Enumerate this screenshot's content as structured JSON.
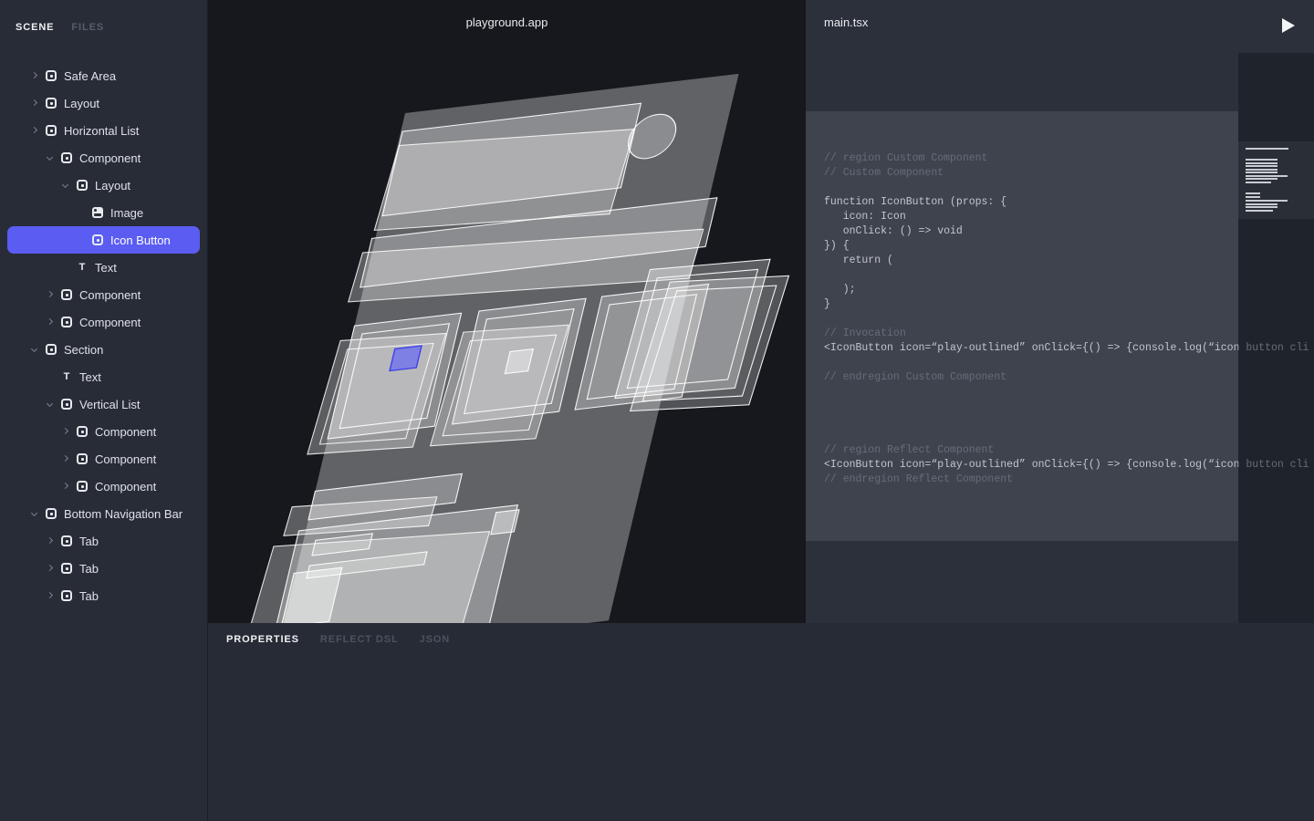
{
  "sidebar": {
    "tabs": [
      {
        "label": "SCENE",
        "active": true
      },
      {
        "label": "FILES",
        "active": false
      }
    ],
    "tree": [
      {
        "label": "Safe Area",
        "depth": 0,
        "arrow": "collapsed",
        "icon": "component",
        "selected": false
      },
      {
        "label": "Layout",
        "depth": 0,
        "arrow": "collapsed",
        "icon": "component",
        "selected": false
      },
      {
        "label": "Horizontal List",
        "depth": 0,
        "arrow": "collapsed",
        "icon": "component",
        "selected": false
      },
      {
        "label": "Component",
        "depth": 1,
        "arrow": "expanded",
        "icon": "component",
        "selected": false
      },
      {
        "label": "Layout",
        "depth": 2,
        "arrow": "expanded",
        "icon": "component",
        "selected": false
      },
      {
        "label": "Image",
        "depth": 3,
        "arrow": "none",
        "icon": "image",
        "selected": false
      },
      {
        "label": "Icon Button",
        "depth": 3,
        "arrow": "none",
        "icon": "component",
        "selected": true
      },
      {
        "label": "Text",
        "depth": 2,
        "arrow": "none",
        "icon": "text",
        "selected": false
      },
      {
        "label": "Component",
        "depth": 1,
        "arrow": "collapsed",
        "icon": "component",
        "selected": false
      },
      {
        "label": "Component",
        "depth": 1,
        "arrow": "collapsed",
        "icon": "component",
        "selected": false
      },
      {
        "label": "Section",
        "depth": 0,
        "arrow": "expanded",
        "icon": "component",
        "selected": false
      },
      {
        "label": "Text",
        "depth": 1,
        "arrow": "none",
        "icon": "text",
        "selected": false
      },
      {
        "label": "Vertical List",
        "depth": 1,
        "arrow": "expanded",
        "icon": "component",
        "selected": false
      },
      {
        "label": "Component",
        "depth": 2,
        "arrow": "collapsed",
        "icon": "component",
        "selected": false
      },
      {
        "label": "Component",
        "depth": 2,
        "arrow": "collapsed",
        "icon": "component",
        "selected": false
      },
      {
        "label": "Component",
        "depth": 2,
        "arrow": "collapsed",
        "icon": "component",
        "selected": false
      },
      {
        "label": "Bottom Navigation Bar",
        "depth": 0,
        "arrow": "expanded",
        "icon": "component",
        "selected": false
      },
      {
        "label": "Tab",
        "depth": 1,
        "arrow": "collapsed",
        "icon": "component",
        "selected": false
      },
      {
        "label": "Tab",
        "depth": 1,
        "arrow": "collapsed",
        "icon": "component",
        "selected": false
      },
      {
        "label": "Tab",
        "depth": 1,
        "arrow": "collapsed",
        "icon": "component",
        "selected": false
      }
    ]
  },
  "canvas": {
    "title": "playground.app"
  },
  "editor": {
    "filename": "main.tsx",
    "play_icon": "play-triangle",
    "code_lines": [
      {
        "type": "comment",
        "text": "// region Custom Component"
      },
      {
        "type": "comment",
        "text": "// Custom Component"
      },
      {
        "type": "blank",
        "text": ""
      },
      {
        "type": "code",
        "text": "function IconButton (props: {"
      },
      {
        "type": "code",
        "text": "   icon: Icon"
      },
      {
        "type": "code",
        "text": "   onClick: () => void"
      },
      {
        "type": "code",
        "text": "}) {"
      },
      {
        "type": "code",
        "text": "   return ("
      },
      {
        "type": "blank",
        "text": ""
      },
      {
        "type": "code",
        "text": "   );"
      },
      {
        "type": "code",
        "text": "}"
      },
      {
        "type": "blank",
        "text": ""
      },
      {
        "type": "comment",
        "text": "// Invocation"
      },
      {
        "type": "code",
        "text": "<IconButton icon=“play-outlined” onClick={() => {console.log(“icon button cli"
      },
      {
        "type": "blank",
        "text": ""
      },
      {
        "type": "comment",
        "text": "// endregion Custom Component"
      },
      {
        "type": "blank",
        "text": ""
      },
      {
        "type": "blank",
        "text": ""
      },
      {
        "type": "blank",
        "text": ""
      },
      {
        "type": "blank",
        "text": ""
      },
      {
        "type": "comment",
        "text": "// region Reflect Component"
      },
      {
        "type": "code",
        "text": "<IconButton icon=“play-outlined” onClick={() => {console.log(“icon button cli"
      },
      {
        "type": "comment",
        "text": "// endregion Reflect Component"
      }
    ],
    "minimap_lines": [
      [
        104,
        47
      ],
      [
        116,
        35
      ],
      [
        119.5,
        35
      ],
      [
        123,
        35
      ],
      [
        126.5,
        35
      ],
      [
        130,
        35
      ],
      [
        133.5,
        46
      ],
      [
        137,
        35
      ],
      [
        140.5,
        28
      ],
      [
        153,
        16
      ],
      [
        156.5,
        16
      ],
      [
        161,
        46
      ],
      [
        164.5,
        35
      ],
      [
        168,
        35
      ],
      [
        171.5,
        30
      ]
    ]
  },
  "bottom_panel": {
    "tabs": [
      {
        "label": "PROPERTIES",
        "active": true
      },
      {
        "label": "REFLECT DSL",
        "active": false
      },
      {
        "label": "JSON",
        "active": false
      }
    ]
  },
  "colors": {
    "selection_blue": "#5A5CF2",
    "canvas_selection_fill": "#6E70F0",
    "canvas_selection_stroke": "#3E40E8",
    "sidebar_bg": "#282C37",
    "canvas_bg": "#16181E",
    "panel_bg": "#2B303B",
    "code_block_bg": "#3E434E",
    "minimap_bg": "#22262F",
    "bottom_panel_bg": "#272B35"
  }
}
